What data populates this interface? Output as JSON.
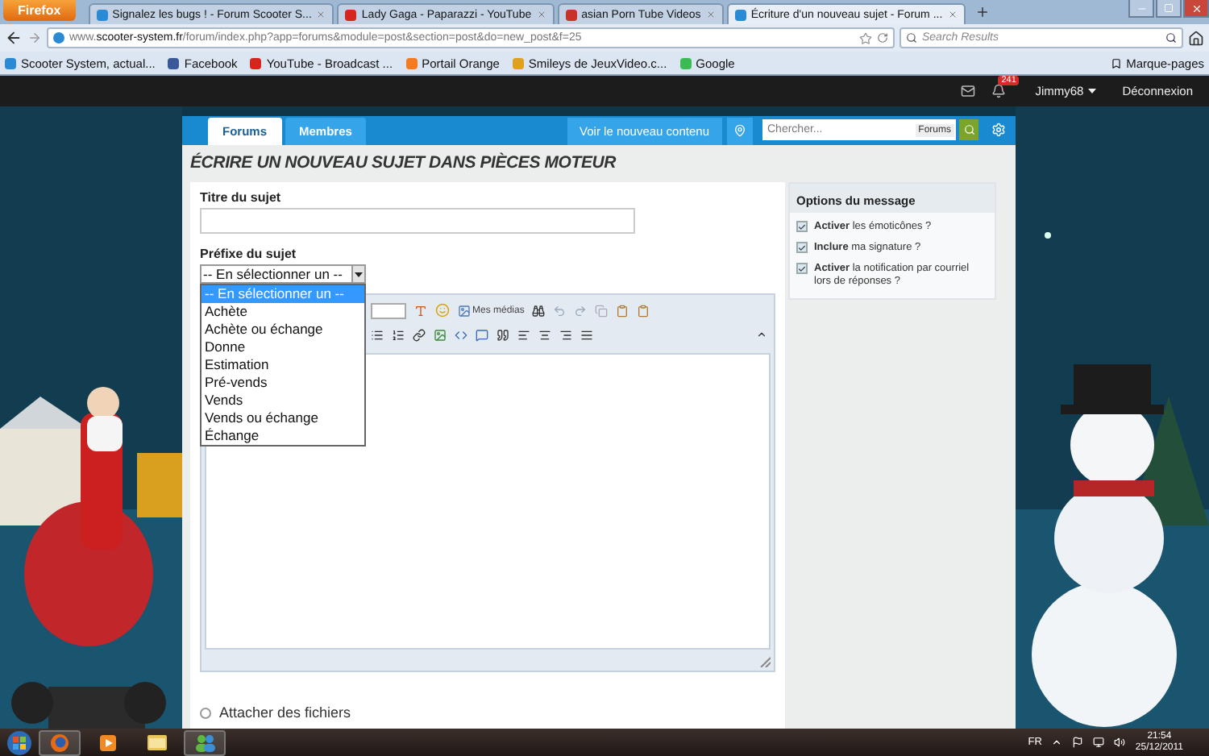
{
  "browser": {
    "menu_button": "Firefox",
    "tabs": [
      {
        "title": "Signalez les bugs ! - Forum Scooter S...",
        "selected": false,
        "color": "#2a8ad4"
      },
      {
        "title": "Lady Gaga - Paparazzi - YouTube",
        "selected": false,
        "color": "#d4261e"
      },
      {
        "title": "asian Porn Tube Videos",
        "selected": false,
        "color": "#c8322a"
      },
      {
        "title": "Écriture d'un nouveau sujet - Forum ...",
        "selected": true,
        "color": "#2a8ad4"
      }
    ],
    "url": "www.**scooter-system.fr**/forum/index.php?app=forums&module=post&section=post&do=new_post&f=25",
    "search_placeholder": "Search Results",
    "bookmarks": [
      {
        "label": "Scooter System, actual...",
        "color": "#2a8ad4"
      },
      {
        "label": "Facebook",
        "color": "#3b5998"
      },
      {
        "label": "YouTube - Broadcast ...",
        "color": "#d4261e"
      },
      {
        "label": "Portail Orange",
        "color": "#f47b20"
      },
      {
        "label": "Smileys de JeuxVideo.c...",
        "color": "#e0a020"
      },
      {
        "label": "Google",
        "color": "#3cba54"
      }
    ],
    "bookmarks_menu": "Marque-pages"
  },
  "site_bar": {
    "notification_count": "241",
    "user": "Jimmy68",
    "logout": "Déconnexion"
  },
  "nav": {
    "tabs": [
      {
        "label": "Forums",
        "selected": true
      },
      {
        "label": "Membres",
        "selected": false
      }
    ],
    "new_content": "Voir le nouveau contenu",
    "search": {
      "placeholder": "Chercher...",
      "scope": "Forums"
    }
  },
  "page_title": "ÉCRIRE UN NOUVEAU SUJET DANS PIÈCES MOTEUR",
  "form": {
    "title_label": "Titre du sujet",
    "prefix_label": "Préfixe du sujet",
    "prefix_select": {
      "value": "-- En sélectionner un --",
      "expanded": true
    },
    "prefix_options": [
      {
        "label": "-- En sélectionner un --",
        "selected": true
      },
      {
        "label": "Achète",
        "selected": false
      },
      {
        "label": "Achète ou échange",
        "selected": false
      },
      {
        "label": "Donne",
        "selected": false
      },
      {
        "label": "Estimation",
        "selected": false
      },
      {
        "label": "Pré-vends",
        "selected": false
      },
      {
        "label": "Vends",
        "selected": false
      },
      {
        "label": "Vends ou échange",
        "selected": false
      },
      {
        "label": "Échange",
        "selected": false
      }
    ],
    "media_button": "Mes médias",
    "attach": {
      "label": "Attacher des fichiers",
      "checked": false
    }
  },
  "options": {
    "title": "Options du message",
    "items": [
      {
        "text": "**Activer** les émoticônes ?",
        "checked": true
      },
      {
        "text": "**Inclure** ma signature ?",
        "checked": true
      },
      {
        "text": "**Activer** la notification par courriel lors de réponses ?",
        "checked": true
      }
    ]
  },
  "taskbar": {
    "apps": [
      {
        "kind": "browser",
        "active": true
      },
      {
        "kind": "media",
        "active": false
      },
      {
        "kind": "folder",
        "active": false
      },
      {
        "kind": "messenger",
        "active": true
      }
    ],
    "language": "FR",
    "time": "21:54",
    "date": "25/12/2011"
  }
}
